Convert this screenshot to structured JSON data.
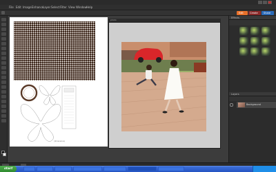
{
  "app": {
    "menu": [
      "File",
      "Edit",
      "Image",
      "Enhance",
      "Layer",
      "Select",
      "Filter",
      "View",
      "Window",
      "Help"
    ],
    "mode_buttons": [
      "Edit",
      "Create",
      "Share"
    ]
  },
  "document1": {
    "caption": "(dimensions)"
  },
  "document2": {
    "tab_title": "photo"
  },
  "panels": {
    "effects_header": "Effects",
    "layers_header": "Layers",
    "layer_name": "Background"
  },
  "taskbar": {
    "start_label": "start",
    "tasks": [
      "",
      "",
      "",
      "",
      "",
      "",
      ""
    ],
    "clock": ""
  },
  "colors": {
    "accent": "#e8702a",
    "taskbar_blue": "#2453c2",
    "start_green": "#2f8a2f",
    "workspace": "#3c3c3c"
  }
}
